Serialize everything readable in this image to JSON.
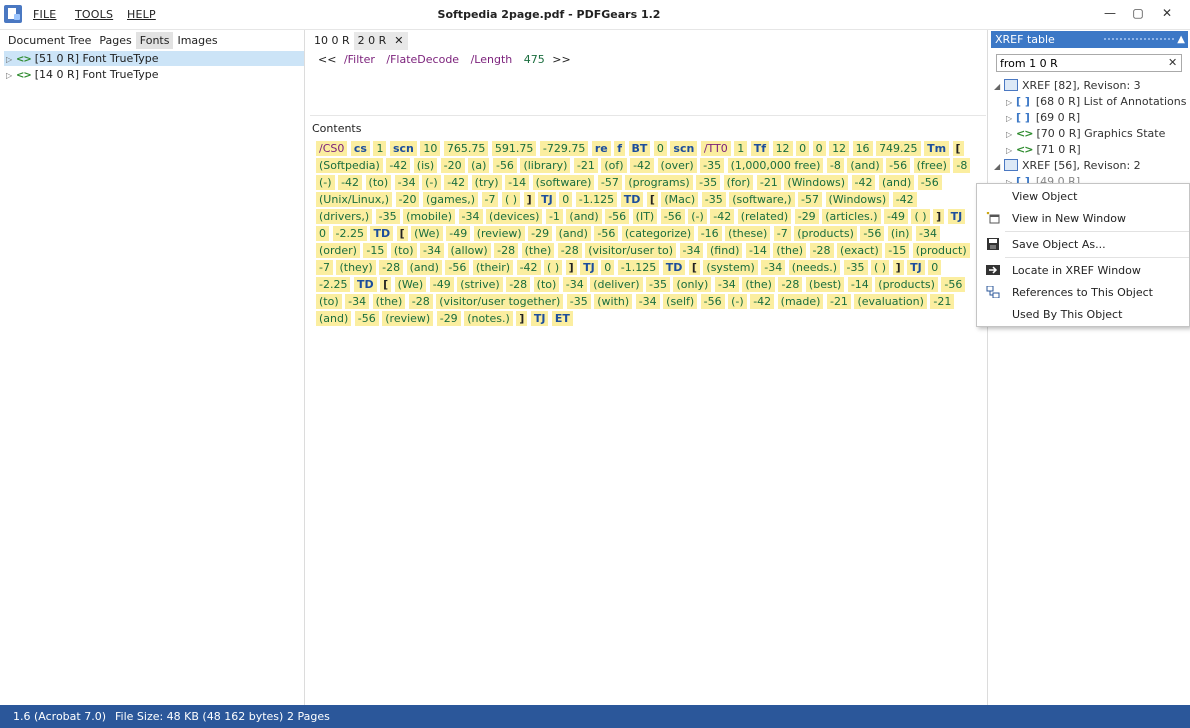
{
  "window": {
    "title": "Softpedia 2page.pdf - PDFGears 1.2",
    "menu": [
      "FILE",
      "TOOLS",
      "HELP"
    ],
    "minimize": "—",
    "maximize": "▢",
    "close": "✕"
  },
  "left_panel": {
    "tabs": [
      "Document Tree",
      "Pages",
      "Fonts",
      "Images"
    ],
    "active_tab": "Fonts",
    "items": [
      {
        "label": "[51 0 R] Font TrueType",
        "selected": true
      },
      {
        "label": "[14 0 R] Font TrueType",
        "selected": false
      }
    ]
  },
  "center_panel": {
    "tabs": [
      "1 0 0 R",
      "2 0 R"
    ],
    "tab_labels": [
      "10 0 R",
      "2 0 R"
    ],
    "active_tab": "2 0 R",
    "dictionary": {
      "open": "<<",
      "filter_key": "/Filter",
      "filter_value": "/FlateDecode",
      "length_key": "/Length",
      "length_value": "475",
      "close": ">>"
    },
    "contents_label": "Contents",
    "tokens": [
      [
        "nm",
        "/CS0"
      ],
      [
        "op",
        "cs"
      ],
      [
        "n",
        "1"
      ],
      [
        "op",
        "scn"
      ],
      [
        "n",
        "10"
      ],
      [
        "n",
        "765.75"
      ],
      [
        "n",
        "591.75"
      ],
      [
        "n",
        "-729.75"
      ],
      [
        "op",
        "re"
      ],
      [
        "op",
        "f"
      ],
      [
        "op",
        "BT"
      ],
      [
        "n",
        "0"
      ],
      [
        "op",
        "scn"
      ],
      [
        "nm",
        "/TT0"
      ],
      [
        "n",
        "1"
      ],
      [
        "op",
        "Tf"
      ],
      [
        "n",
        "12"
      ],
      [
        "n",
        "0"
      ],
      [
        "n",
        "0"
      ],
      [
        "n",
        "12"
      ],
      [
        "n",
        "16"
      ],
      [
        "n",
        "749.25"
      ],
      [
        "op",
        "Tm"
      ],
      [
        "p",
        "["
      ],
      [
        "s",
        "(Softpedia)"
      ],
      [
        "n",
        "-42"
      ],
      [
        "s",
        "(is)"
      ],
      [
        "n",
        "-20"
      ],
      [
        "s",
        "(a)"
      ],
      [
        "n",
        "-56"
      ],
      [
        "s",
        "(library)"
      ],
      [
        "n",
        "-21"
      ],
      [
        "s",
        "(of)"
      ],
      [
        "n",
        "-42"
      ],
      [
        "s",
        "(over)"
      ],
      [
        "n",
        "-35"
      ],
      [
        "s",
        "(1,000,000 free)"
      ],
      [
        "n",
        "-8"
      ],
      [
        "s",
        "(and)"
      ],
      [
        "n",
        "-56"
      ],
      [
        "s",
        "(free)"
      ],
      [
        "n",
        "-8"
      ],
      [
        "s",
        "(-)"
      ],
      [
        "n",
        "-42"
      ],
      [
        "s",
        "(to)"
      ],
      [
        "n",
        "-34"
      ],
      [
        "s",
        "(-)"
      ],
      [
        "n",
        "-42"
      ],
      [
        "s",
        "(try)"
      ],
      [
        "n",
        "-14"
      ],
      [
        "s",
        "(software)"
      ],
      [
        "n",
        "-57"
      ],
      [
        "s",
        "(programs)"
      ],
      [
        "n",
        "-35"
      ],
      [
        "s",
        "(for)"
      ],
      [
        "n",
        "-21"
      ],
      [
        "s",
        "(Windows)"
      ],
      [
        "n",
        "-42"
      ],
      [
        "s",
        "(and)"
      ],
      [
        "n",
        "-56"
      ],
      [
        "s",
        "(Unix/Linux,)"
      ],
      [
        "n",
        "-20"
      ],
      [
        "s",
        "(games,)"
      ],
      [
        "n",
        "-7"
      ],
      [
        "s",
        "( )"
      ],
      [
        "p",
        "]"
      ],
      [
        "op",
        "TJ"
      ],
      [
        "n",
        "0"
      ],
      [
        "n",
        "-1.125"
      ],
      [
        "op",
        "TD"
      ],
      [
        "p",
        "["
      ],
      [
        "s",
        "(Mac)"
      ],
      [
        "n",
        "-35"
      ],
      [
        "s",
        "(software,)"
      ],
      [
        "n",
        "-57"
      ],
      [
        "s",
        "(Windows)"
      ],
      [
        "n",
        "-42"
      ],
      [
        "s",
        "(drivers,)"
      ],
      [
        "n",
        "-35"
      ],
      [
        "s",
        "(mobile)"
      ],
      [
        "n",
        "-34"
      ],
      [
        "s",
        "(devices)"
      ],
      [
        "n",
        "-1"
      ],
      [
        "s",
        "(and)"
      ],
      [
        "n",
        "-56"
      ],
      [
        "s",
        "(IT)"
      ],
      [
        "n",
        "-56"
      ],
      [
        "s",
        "(-)"
      ],
      [
        "n",
        "-42"
      ],
      [
        "s",
        "(related)"
      ],
      [
        "n",
        "-29"
      ],
      [
        "s",
        "(articles.)"
      ],
      [
        "n",
        "-49"
      ],
      [
        "s",
        "( )"
      ],
      [
        "p",
        "]"
      ],
      [
        "op",
        "TJ"
      ],
      [
        "n",
        "0"
      ],
      [
        "n",
        "-2.25"
      ],
      [
        "op",
        "TD"
      ],
      [
        "p",
        "["
      ],
      [
        "s",
        "(We)"
      ],
      [
        "n",
        "-49"
      ],
      [
        "s",
        "(review)"
      ],
      [
        "n",
        "-29"
      ],
      [
        "s",
        "(and)"
      ],
      [
        "n",
        "-56"
      ],
      [
        "s",
        "(categorize)"
      ],
      [
        "n",
        "-16"
      ],
      [
        "s",
        "(these)"
      ],
      [
        "n",
        "-7"
      ],
      [
        "s",
        "(products)"
      ],
      [
        "n",
        "-56"
      ],
      [
        "s",
        "(in)"
      ],
      [
        "n",
        "-34"
      ],
      [
        "s",
        "(order)"
      ],
      [
        "n",
        "-15"
      ],
      [
        "s",
        "(to)"
      ],
      [
        "n",
        "-34"
      ],
      [
        "s",
        "(allow)"
      ],
      [
        "n",
        "-28"
      ],
      [
        "s",
        "(the)"
      ],
      [
        "n",
        "-28"
      ],
      [
        "s",
        "(visitor/user to)"
      ],
      [
        "n",
        "-34"
      ],
      [
        "s",
        "(find)"
      ],
      [
        "n",
        "-14"
      ],
      [
        "s",
        "(the)"
      ],
      [
        "n",
        "-28"
      ],
      [
        "s",
        "(exact)"
      ],
      [
        "n",
        "-15"
      ],
      [
        "s",
        "(product)"
      ],
      [
        "n",
        "-7"
      ],
      [
        "s",
        "(they)"
      ],
      [
        "n",
        "-28"
      ],
      [
        "s",
        "(and)"
      ],
      [
        "n",
        "-56"
      ],
      [
        "s",
        "(their)"
      ],
      [
        "n",
        "-42"
      ],
      [
        "s",
        "( )"
      ],
      [
        "p",
        "]"
      ],
      [
        "op",
        "TJ"
      ],
      [
        "n",
        "0"
      ],
      [
        "n",
        "-1.125"
      ],
      [
        "op",
        "TD"
      ],
      [
        "p",
        "["
      ],
      [
        "s",
        "(system)"
      ],
      [
        "n",
        "-34"
      ],
      [
        "s",
        "(needs.)"
      ],
      [
        "n",
        "-35"
      ],
      [
        "s",
        "( )"
      ],
      [
        "p",
        "]"
      ],
      [
        "op",
        "TJ"
      ],
      [
        "n",
        "0"
      ],
      [
        "n",
        "-2.25"
      ],
      [
        "op",
        "TD"
      ],
      [
        "p",
        "["
      ],
      [
        "s",
        "(We)"
      ],
      [
        "n",
        "-49"
      ],
      [
        "s",
        "(strive)"
      ],
      [
        "n",
        "-28"
      ],
      [
        "s",
        "(to)"
      ],
      [
        "n",
        "-34"
      ],
      [
        "s",
        "(deliver)"
      ],
      [
        "n",
        "-35"
      ],
      [
        "s",
        "(only)"
      ],
      [
        "n",
        "-34"
      ],
      [
        "s",
        "(the)"
      ],
      [
        "n",
        "-28"
      ],
      [
        "s",
        "(best)"
      ],
      [
        "n",
        "-14"
      ],
      [
        "s",
        "(products)"
      ],
      [
        "n",
        "-56"
      ],
      [
        "s",
        "(to)"
      ],
      [
        "n",
        "-34"
      ],
      [
        "s",
        "(the)"
      ],
      [
        "n",
        "-28"
      ],
      [
        "s",
        "(visitor/user together)"
      ],
      [
        "n",
        "-35"
      ],
      [
        "s",
        "(with)"
      ],
      [
        "n",
        "-34"
      ],
      [
        "s",
        "(self)"
      ],
      [
        "n",
        "-56"
      ],
      [
        "s",
        "(-)"
      ],
      [
        "n",
        "-42"
      ],
      [
        "s",
        "(made)"
      ],
      [
        "n",
        "-21"
      ],
      [
        "s",
        "(evaluation)"
      ],
      [
        "n",
        "-21"
      ],
      [
        "s",
        "(and)"
      ],
      [
        "n",
        "-56"
      ],
      [
        "s",
        "(review)"
      ],
      [
        "n",
        "-29"
      ],
      [
        "s",
        "(notes.)"
      ],
      [
        "p",
        "]"
      ],
      [
        "op",
        "TJ"
      ],
      [
        "op",
        "ET"
      ]
    ]
  },
  "right_panel": {
    "title": "XREF table",
    "pin": "▲",
    "search_value": "from 1 0 R",
    "clear": "✕",
    "items": [
      {
        "label": "XREF [82], Revison: 3",
        "kind": "xref"
      },
      {
        "label": "[68 0 R] List of Annotations",
        "kind": "array"
      },
      {
        "label": "[69 0 R]",
        "kind": "array"
      },
      {
        "label": "[70 0 R] Graphics State",
        "kind": "dict"
      },
      {
        "label": "[71 0 R]",
        "kind": "dict"
      },
      {
        "label": "XREF [56], Revison: 2",
        "kind": "xref"
      },
      {
        "label": "[49 0 R]",
        "kind": "array"
      }
    ]
  },
  "context_menu": {
    "items": [
      "View Object",
      "View in New Window",
      "Save Object As...",
      "Locate in XREF Window",
      "References to This Object",
      "Used By This Object"
    ]
  },
  "status_bar": {
    "version": "1.6 (Acrobat 7.0)",
    "file_size": "File Size: 48  KB (48 162  bytes)",
    "pages": "2 Pages"
  }
}
